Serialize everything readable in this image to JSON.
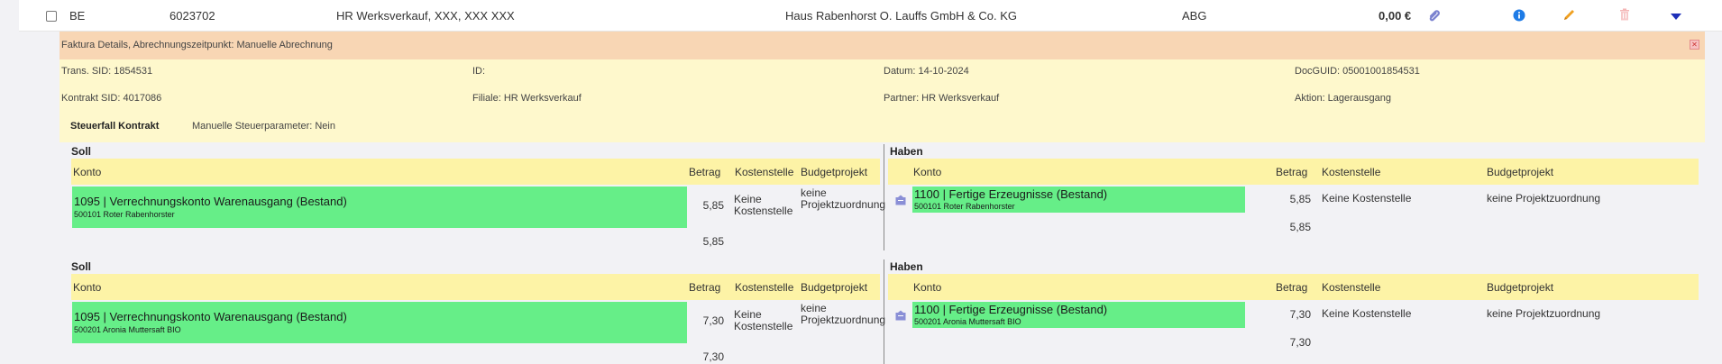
{
  "row": {
    "type": "BE",
    "number": "6023702",
    "customer": "HR Werksverkauf, XXX, XXX XXX",
    "partner": "Haus Rabenhorst O. Lauffs GmbH & Co. KG",
    "code": "ABG",
    "amount": "0,00 €"
  },
  "details": {
    "header": "Faktura Details, Abrechnungszeitpunkt: Manuelle Abrechnung",
    "trans_sid": "Trans. SID: 1854531",
    "id": "ID:",
    "datum": "Datum: 14-10-2024",
    "docguid": "DocGUID: 05001001854531",
    "kontrakt_sid": "Kontrakt SID: 4017086",
    "filiale": "Filiale: HR Werksverkauf",
    "partner": "Partner: HR Werksverkauf",
    "aktion": "Aktion: Lagerausgang",
    "steuerfall": "Steuerfall Kontrakt",
    "manuelle_steuer": "Manuelle Steuerparameter: Nein"
  },
  "columns": {
    "konto": "Konto",
    "betrag": "Betrag",
    "kostenstelle": "Kostenstelle",
    "budgetprojekt": "Budgetprojekt"
  },
  "bookings": [
    {
      "soll": {
        "title": "Soll",
        "konto_main": "1095 | Verrechnungskonto Warenausgang (Bestand)",
        "konto_sub": "500101 Roter Rabenhorster",
        "betrag": "5,85",
        "kostenstelle": "Keine Kostenstelle",
        "budgetprojekt": "keine Projektzuordnung",
        "sum": "5,85"
      },
      "haben": {
        "title": "Haben",
        "konto_main": "1100 | Fertige Erzeugnisse (Bestand)",
        "konto_sub": "500101 Roter Rabenhorster",
        "betrag": "5,85",
        "kostenstelle": "Keine Kostenstelle",
        "budgetprojekt": "keine Projektzuordnung",
        "sum": "5,85"
      }
    },
    {
      "soll": {
        "title": "Soll",
        "konto_main": "1095 | Verrechnungskonto Warenausgang (Bestand)",
        "konto_sub": "500201 Aronia Muttersaft BIO",
        "betrag": "7,30",
        "kostenstelle": "Keine Kostenstelle",
        "budgetprojekt": "keine Projektzuordnung",
        "sum": "7,30"
      },
      "haben": {
        "title": "Haben",
        "konto_main": "1100 | Fertige Erzeugnisse (Bestand)",
        "konto_sub": "500201 Aronia Muttersaft BIO",
        "betrag": "7,30",
        "kostenstelle": "Keine Kostenstelle",
        "budgetprojekt": "keine Projektzuordnung",
        "sum": "7,30"
      }
    }
  ],
  "icons": {
    "attachment": "paperclip-icon",
    "info": "info-icon",
    "edit": "pencil-icon",
    "delete": "trash-icon",
    "expand": "triangle-down-icon",
    "close": "close-icon",
    "document": "document-icon"
  },
  "colors": {
    "konto_bg": "#66ee88",
    "header_bar": "#fdf3a6",
    "details_bg": "#fef8cc",
    "details_header": "#f8d6b4",
    "info": "#1e7be6",
    "edit": "#f0a020",
    "expand": "#1d2fb8"
  }
}
